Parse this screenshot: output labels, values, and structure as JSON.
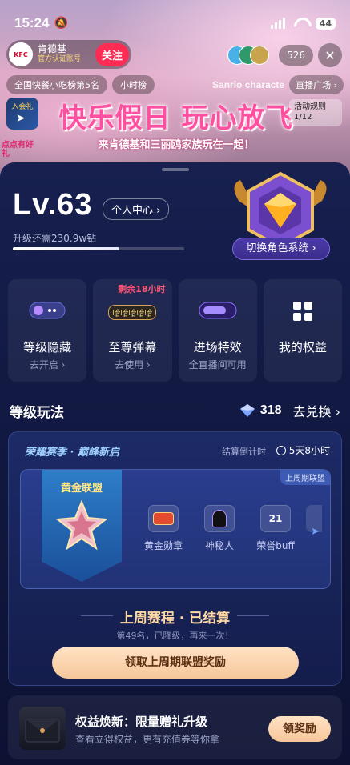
{
  "status_bar": {
    "time": "15:24",
    "battery": "44"
  },
  "live_header": {
    "host_name": "肯德基",
    "host_tag": "官方认证账号",
    "host_avatar_text": "KFC",
    "follow_label": "关注",
    "viewer_count": "526",
    "rank_chip": "全国快餐小吃榜第5名",
    "hour_chip": "小时榜",
    "sanrio_text": "Sanrio characte",
    "plaza_chip": "直播广场 ›",
    "banner_title": "快乐假日 玩心放飞",
    "banner_subtitle": "来肯德基和三丽鸥家族玩在一起！",
    "entry_badge": "入会礼",
    "tap_bubble": "点点有好礼",
    "rule_card_title": "活动规则",
    "rule_card_page": "1/12"
  },
  "level": {
    "title": "Lv.63",
    "personal_center": "个人中心 ›",
    "upgrade_text": "升级还需230.9w钻",
    "progress_percent": 62,
    "switch_role": "切换角色系统 ›"
  },
  "cards": [
    {
      "title": "等级隐藏",
      "sub": "去开启 ›",
      "icon": "hide-icon",
      "remain": ""
    },
    {
      "title": "至尊弹幕",
      "sub": "去使用 ›",
      "icon": "danmaku-icon",
      "remain": "剩余18小时",
      "bubble": "哈哈哈哈哈"
    },
    {
      "title": "进场特效",
      "sub": "全直播间可用",
      "icon": "entry-effect-icon",
      "remain": ""
    },
    {
      "title": "我的权益",
      "sub": "",
      "icon": "grid-icon",
      "remain": ""
    }
  ],
  "level_play": {
    "section_title": "等级玩法",
    "gem_count": "318",
    "exchange": "去兑换 ›"
  },
  "league": {
    "season_title": "荣耀赛季 · 巅峰新启",
    "countdown_label": "结算倒计时",
    "countdown_value": "5天8小时",
    "last_tag": "上周期联盟",
    "league_name": "黄金联盟",
    "rewards": [
      {
        "label": "黄金勋章",
        "icon": "gold-medal-icon",
        "text": ""
      },
      {
        "label": "神秘人",
        "icon": "mystery-icon",
        "text": ""
      },
      {
        "label": "荣誉buff",
        "icon": "honor-buff-icon",
        "text": "21"
      }
    ],
    "result_title": "上周赛程 · 已结算",
    "result_sub": "第49名，已降级，再来一次！",
    "claim_button": "领取上周期联盟奖励"
  },
  "promo": {
    "title": "权益焕新：限量赠礼升级",
    "sub": "查看立得权益，更有充值券等你拿",
    "button": "领奖励"
  },
  "colors": {
    "follow": "#fe2c55",
    "banner_pink": "#ff4fa0",
    "sheet_bg": "#17204f",
    "gold_button": "#f6c79a",
    "remain_red": "#ff5473"
  }
}
